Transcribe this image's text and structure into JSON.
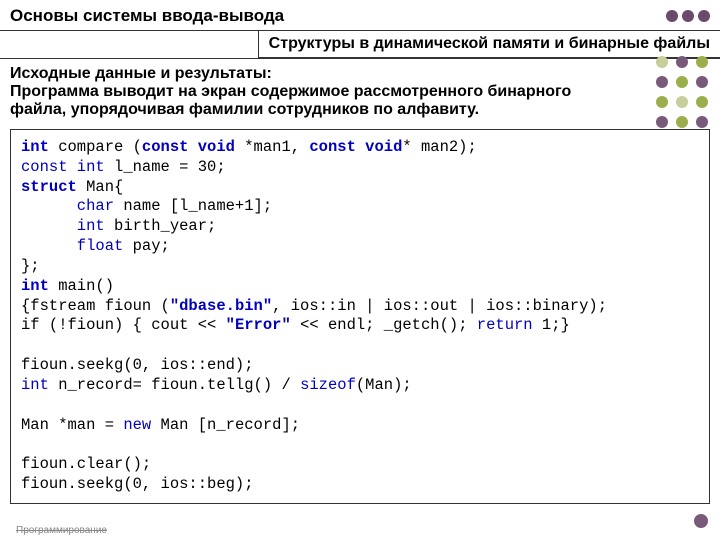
{
  "title": "Основы системы ввода-вывода",
  "subtitle": "Структуры в динамической памяти и бинарные файлы",
  "description_l1": "Исходные данные и результаты:",
  "description_l2": "Программа выводит на экран содержимое рассмотренного бинарного",
  "description_l3": "файла, упорядочивая фамилии сотрудников по алфавиту.",
  "code": {
    "l01a": "int",
    "l01b": " compare (",
    "l01c": "const void",
    "l01d": " *man1, ",
    "l01e": "const void",
    "l01f": "* man2);",
    "l02a": "const int",
    "l02b": " l_name = 30;",
    "l03a": "struct",
    "l03b": " Man{",
    "l04a": "      char",
    "l04b": " name [l_name+1];",
    "l05a": "      int",
    "l05b": " birth_year;",
    "l06a": "      float",
    "l06b": " pay;",
    "l07": "};",
    "l08a": "int",
    "l08b": " main()",
    "l09a": "{fstream fioun (",
    "l09b": "\"dbase.bin\"",
    "l09c": ", ios::in | ios::out | ios::binary);",
    "l10a": "if (!fioun) { cout << ",
    "l10b": "\"Error\"",
    "l10c": " << endl; _getch(); ",
    "l10d": "return",
    "l10e": " 1;}",
    "l11": "",
    "l12": "fioun.seekg(0, ios::end);",
    "l13a": "int",
    "l13b": " n_record= fioun.tellg() / ",
    "l13c": "sizeof",
    "l13d": "(Man);",
    "l14": "",
    "l15a": "Man *man = ",
    "l15b": "new",
    "l15c": " Man [n_record];",
    "l16": "",
    "l17": "fioun.clear();",
    "l18": "fioun.seekg(0, ios::beg);"
  },
  "footer": "Программирование"
}
